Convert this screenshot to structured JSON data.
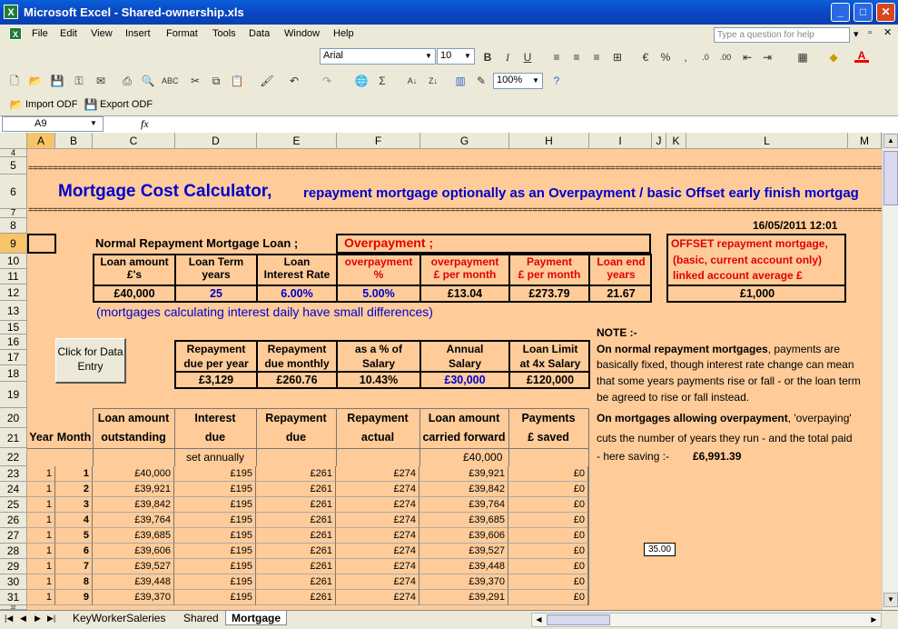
{
  "window": {
    "title": "Microsoft Excel - Shared-ownership.xls"
  },
  "menu": [
    "File",
    "Edit",
    "View",
    "Insert",
    "Format",
    "Tools",
    "Data",
    "Window",
    "Help"
  ],
  "help_placeholder": "Type a question for help",
  "font": {
    "name": "Arial",
    "size": "10"
  },
  "zoom": "100%",
  "odf": {
    "import": "Import ODF",
    "export": "Export ODF"
  },
  "namebox": "A9",
  "fx": "fx",
  "columns": [
    "A",
    "B",
    "C",
    "D",
    "E",
    "F",
    "G",
    "H",
    "I",
    "J",
    "K",
    "L",
    "M"
  ],
  "rows": [
    "4",
    "5",
    "6",
    "7",
    "8",
    "9",
    "10",
    "11",
    "12",
    "13",
    "15",
    "16",
    "17",
    "18",
    "19",
    "20",
    "21",
    "22",
    "23",
    "24",
    "25",
    "26",
    "27",
    "28",
    "29",
    "30",
    "31",
    "32"
  ],
  "sheet": {
    "title": "Mortgage Cost Calculator,",
    "subtitle": "repayment mortgage optionally as an Overpayment / basic Offset early finish mortgag",
    "datetime": "16/05/2011 12:01",
    "normal_title": "Normal Repayment Mortgage Loan ;",
    "over_title": "Overpayment  ;",
    "offset_title": "OFFSET repayment mortgage,",
    "offset_sub1": "(basic, current account only)",
    "offset_sub2": "linked account average £",
    "h_loan1": "Loan amount",
    "h_loan2": "£'s",
    "h_term1": "Loan Term",
    "h_term2": "years",
    "h_rate1": "Loan",
    "h_rate2": "Interest Rate",
    "h_op1": "overpayment",
    "h_op2": "%",
    "h_opm1": "overpayment",
    "h_opm2": "£ per month",
    "h_pay1": "Payment",
    "h_pay2": "£ per month",
    "h_end1": "Loan end",
    "h_end2": "years",
    "v_loan": "£40,000",
    "v_term": "25",
    "v_rate": "6.00%",
    "v_op": "5.00%",
    "v_opm": "£13.04",
    "v_pay": "£273.79",
    "v_end": "21.67",
    "v_offset": "£1,000",
    "note_daily": "(mortgages calculating interest daily have small differences)",
    "button": "Click for Data Entry",
    "r_h1a": "Repayment",
    "r_h1b": "due per year",
    "r_h2a": "Repayment",
    "r_h2b": "due monthly",
    "r_h3a": "as a % of",
    "r_h3b": "Salary",
    "r_h4a": "Annual",
    "r_h4b": "Salary",
    "r_h5a": "Loan Limit",
    "r_h5b": "at 4x Salary",
    "r_v1": "£3,129",
    "r_v2": "£260.76",
    "r_v3": "10.43%",
    "r_v4": "£30,000",
    "r_v5": "£120,000",
    "note_title": "NOTE :-",
    "note1a": "On normal repayment mortgages",
    "note1b": ", payments are",
    "note2": "basically fixed, though interest rate change can mean",
    "note3": "that some years payments rise or fall - or the loan term",
    "note4": "be agreed to rise or fall instead.",
    "note5a": "On mortgages allowing overpayment",
    "note5b": ", 'overpaying'",
    "note6": "cuts the number of years they run - and the total paid",
    "note7": "- here saving :-",
    "saving": "£6,991.39",
    "popup": "35.00"
  },
  "schedule": {
    "headers1": [
      "",
      "",
      "Loan amount",
      "Interest",
      "Repayment",
      "Repayment",
      "Loan amount",
      "Payments"
    ],
    "headers2": [
      "Year",
      "Month",
      "outstanding",
      "due",
      "due",
      "actual",
      "carried forward",
      "£ saved"
    ],
    "row22": {
      "interest": "set annually",
      "cf": "£40,000"
    },
    "rows": [
      [
        "1",
        "1",
        "£40,000",
        "£195",
        "£261",
        "£274",
        "£39,921",
        "£0"
      ],
      [
        "1",
        "2",
        "£39,921",
        "£195",
        "£261",
        "£274",
        "£39,842",
        "£0"
      ],
      [
        "1",
        "3",
        "£39,842",
        "£195",
        "£261",
        "£274",
        "£39,764",
        "£0"
      ],
      [
        "1",
        "4",
        "£39,764",
        "£195",
        "£261",
        "£274",
        "£39,685",
        "£0"
      ],
      [
        "1",
        "5",
        "£39,685",
        "£195",
        "£261",
        "£274",
        "£39,606",
        "£0"
      ],
      [
        "1",
        "6",
        "£39,606",
        "£195",
        "£261",
        "£274",
        "£39,527",
        "£0"
      ],
      [
        "1",
        "7",
        "£39,527",
        "£195",
        "£261",
        "£274",
        "£39,448",
        "£0"
      ],
      [
        "1",
        "8",
        "£39,448",
        "£195",
        "£261",
        "£274",
        "£39,370",
        "£0"
      ],
      [
        "1",
        "9",
        "£39,370",
        "£195",
        "£261",
        "£274",
        "£39,291",
        "£0"
      ]
    ]
  },
  "tabs": [
    "KeyWorkerSaleries",
    "Shared",
    "Mortgage"
  ]
}
